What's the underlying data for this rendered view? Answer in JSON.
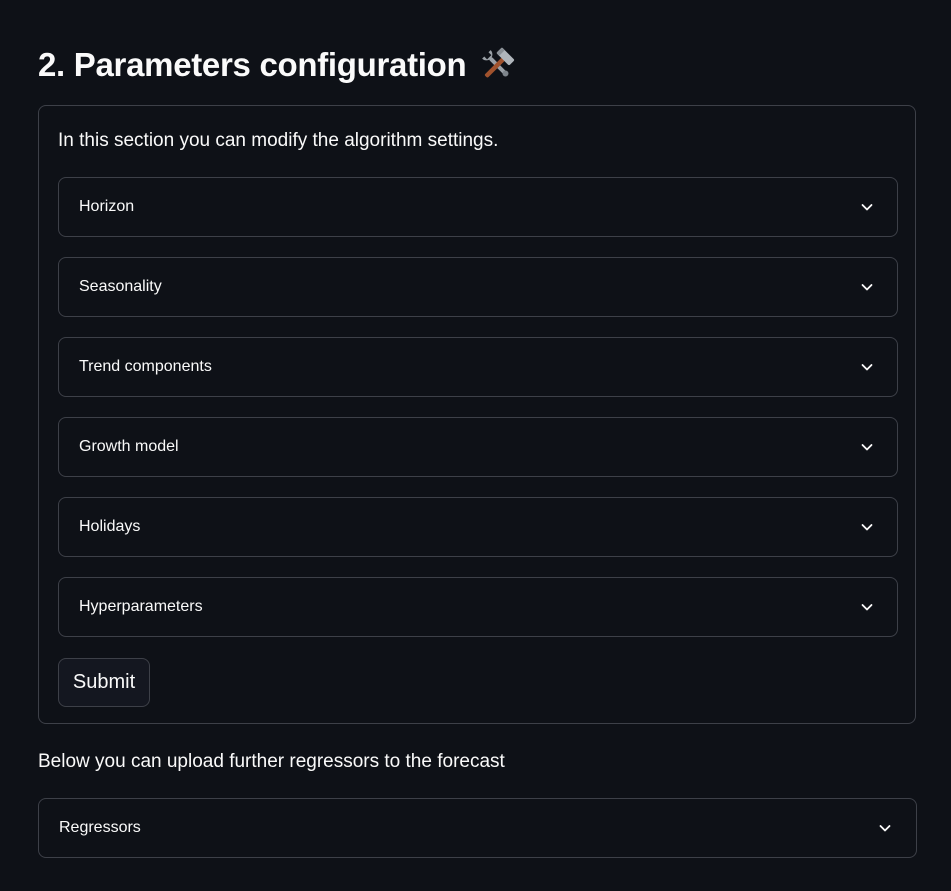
{
  "header": {
    "title": "2. Parameters configuration",
    "title_emoji_icon": "hammer-and-wrench-icon"
  },
  "parameters_form": {
    "intro": "In this section you can modify the algorithm settings.",
    "expanders": [
      {
        "label": "Horizon",
        "icon": "chevron-down-icon"
      },
      {
        "label": "Seasonality",
        "icon": "chevron-down-icon"
      },
      {
        "label": "Trend components",
        "icon": "chevron-down-icon"
      },
      {
        "label": "Growth model",
        "icon": "chevron-down-icon"
      },
      {
        "label": "Holidays",
        "icon": "chevron-down-icon"
      },
      {
        "label": "Hyperparameters",
        "icon": "chevron-down-icon"
      }
    ],
    "submit_label": "Submit"
  },
  "regressors_section": {
    "intro": "Below you can upload further regressors to the forecast",
    "expander_label": "Regressors",
    "icon": "chevron-down-icon"
  },
  "colors": {
    "background": "#0e1117",
    "text": "#fafafa",
    "border": "#3d4048",
    "button_background": "#141720"
  }
}
